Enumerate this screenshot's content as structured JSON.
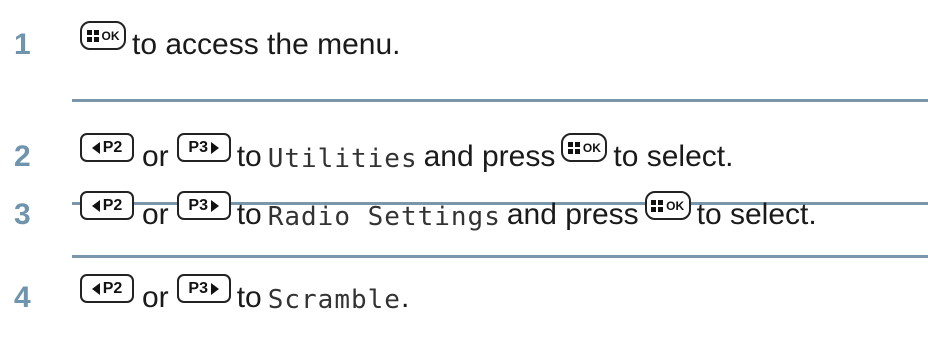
{
  "steps": [
    {
      "number": "1",
      "ok_key_label": "OK",
      "text_after_ok": "to access the menu."
    },
    {
      "number": "2",
      "key_left_label": "P2",
      "or_text": "or",
      "key_right_label": "P3",
      "to_text": "to",
      "menu_item": "Utilities",
      "press_text": "and press",
      "ok_key_label": "OK",
      "end_text": "to select."
    },
    {
      "number": "3",
      "key_left_label": "P2",
      "or_text": "or",
      "key_right_label": "P3",
      "to_text": "to",
      "menu_item": "Radio Settings",
      "press_text": "and press",
      "ok_key_label": "OK",
      "end_text": "to select."
    },
    {
      "number": "4",
      "key_left_label": "P2",
      "or_text": "or",
      "key_right_label": "P3",
      "to_text": "to",
      "menu_item": "Scramble",
      "end_text": "."
    }
  ],
  "colors": {
    "step_number": "#6f94ad",
    "divider": "#7996ab"
  },
  "icons": [
    "menu-ok-key-icon",
    "p2-left-key-icon",
    "p3-right-key-icon"
  ]
}
